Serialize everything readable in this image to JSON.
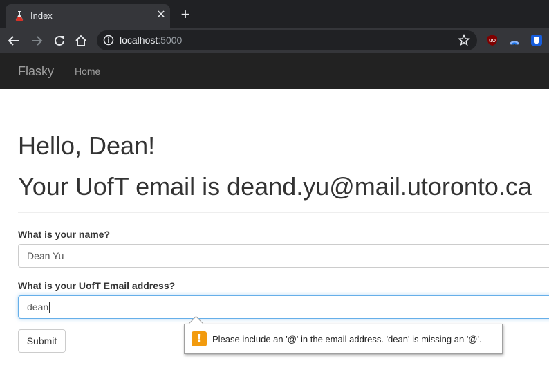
{
  "browser": {
    "tab_title": "Index",
    "new_tab_symbol": "+",
    "close_symbol": "✕",
    "url_host": "localhost",
    "url_port": ":5000"
  },
  "navbar": {
    "brand": "Flasky",
    "links": [
      "Home"
    ]
  },
  "page": {
    "greeting": "Hello, Dean!",
    "email_line": "Your UofT email is deand.yu@mail.utoronto.ca"
  },
  "form": {
    "name_label": "What is your name?",
    "name_value": "Dean Yu",
    "email_label": "What is your UofT Email address?",
    "email_value": "dean",
    "submit_label": "Submit"
  },
  "validation": {
    "icon": "!",
    "message": "Please include an '@' in the email address. 'dean' is missing an '@'."
  },
  "colors": {
    "warning": "#f29b0e",
    "focus_border": "#66afe9",
    "navbar_bg": "#222222"
  }
}
